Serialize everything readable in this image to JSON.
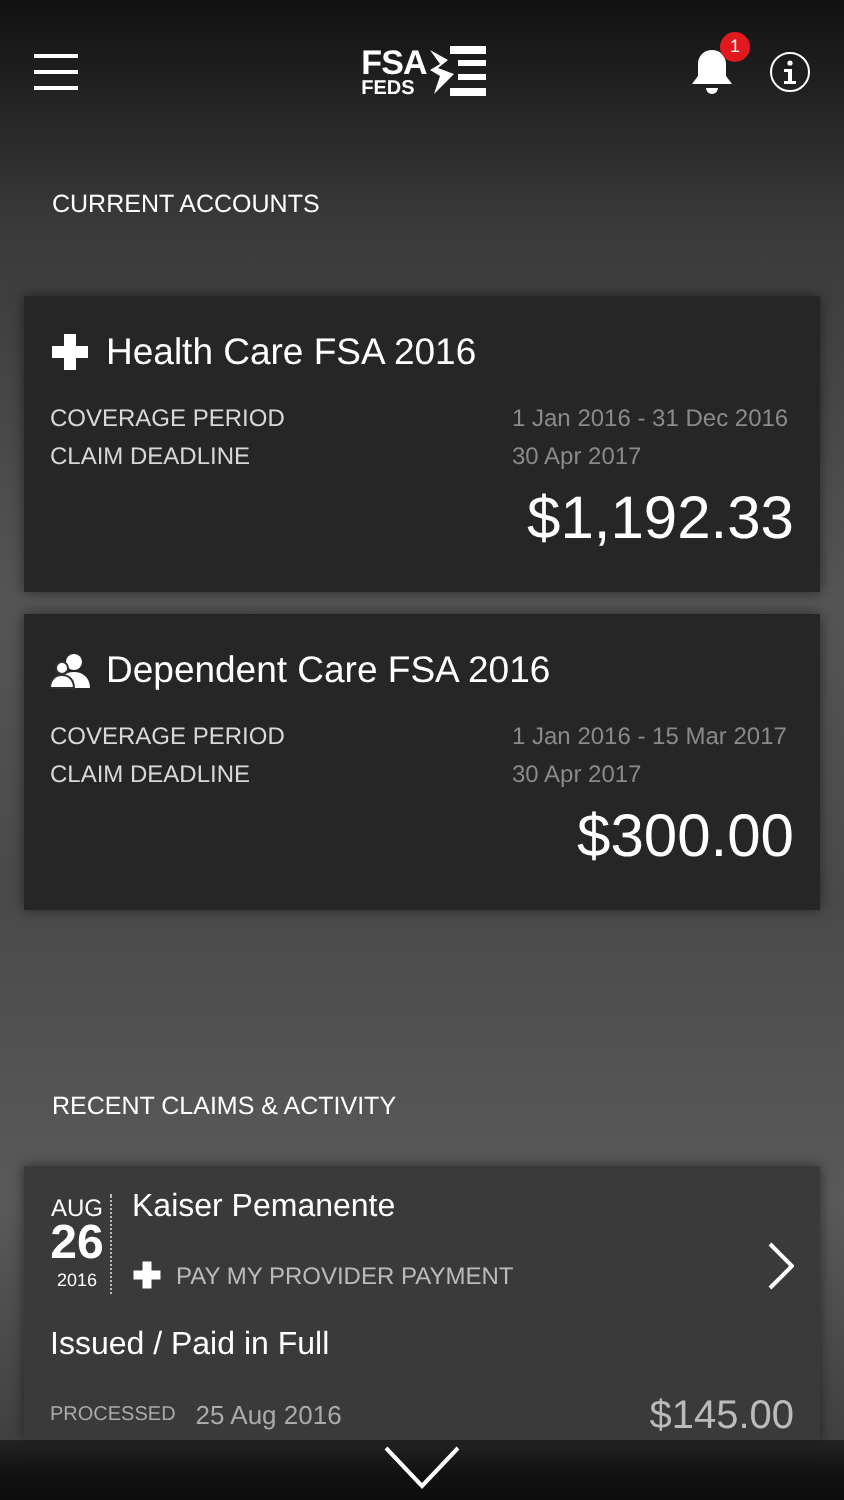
{
  "header": {
    "notification_count": "1"
  },
  "logo": {
    "line_1": "FSA",
    "line_2": "FEDS"
  },
  "accounts_heading": "CURRENT ACCOUNTS",
  "accounts": [
    {
      "kind": "health",
      "name": "Health Care FSA 2016",
      "rows": [
        {
          "label": "COVERAGE PERIOD",
          "value": "1 Jan 2016 - 31 Dec 2016"
        },
        {
          "label": "CLAIM DEADLINE",
          "value": "30 Apr 2017"
        }
      ],
      "balance": "$1,192.33"
    },
    {
      "kind": "dependent",
      "name": "Dependent Care FSA 2016",
      "rows": [
        {
          "label": "COVERAGE PERIOD",
          "value": "1 Jan 2016 - 15 Mar 2017"
        },
        {
          "label": "CLAIM DEADLINE",
          "value": "30 Apr 2017"
        }
      ],
      "balance": "$300.00"
    }
  ],
  "activity_heading": "RECENT CLAIMS & ACTIVITY",
  "claims": [
    {
      "month": "AUG",
      "day": "26",
      "year": "2016",
      "payee": "Kaiser Pemanente",
      "kind": "health",
      "type": "PAY MY PROVIDER PAYMENT",
      "status": "Issued / Paid in Full",
      "processed_label": "PROCESSED",
      "processed_date": "25 Aug 2016",
      "amount": "$145.00"
    }
  ]
}
